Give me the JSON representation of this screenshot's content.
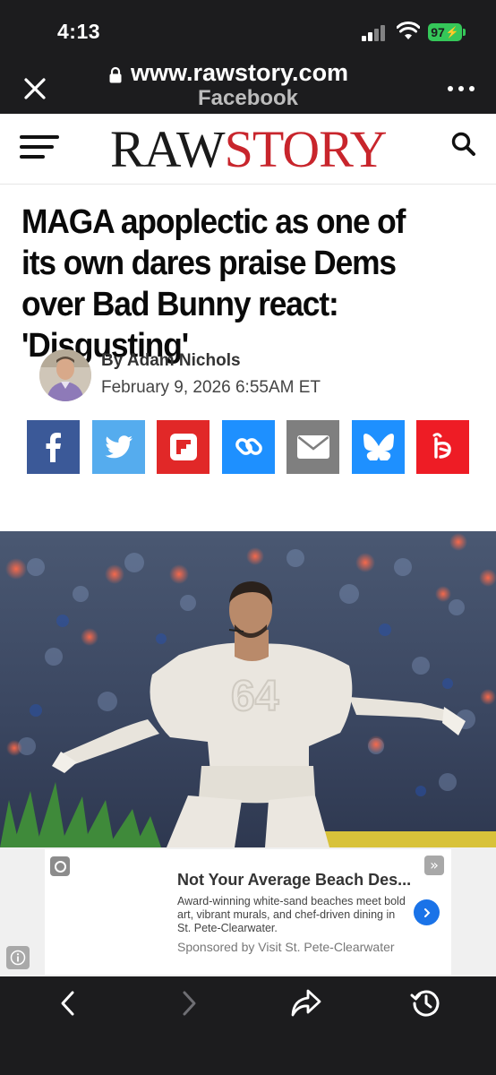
{
  "status_bar": {
    "time": "4:13",
    "battery": "97"
  },
  "browser": {
    "url": "www.rawstory.com",
    "source": "Facebook",
    "icons": [
      "close-icon",
      "lock-icon",
      "more-icon"
    ]
  },
  "site": {
    "logo_raw": "RAW",
    "logo_story": "STORY",
    "brand_color": "#c8252c",
    "icons": [
      "menu-icon",
      "search-icon"
    ]
  },
  "article": {
    "headline": "MAGA apoplectic as one of its own dares praise Dems over Bad Bunny react: 'Disgusting'",
    "byline": "By Adam Nichols",
    "date": "February 9, 2026 6:55AM ET"
  },
  "share": [
    {
      "name": "facebook",
      "color": "#3b5998"
    },
    {
      "name": "twitter",
      "color": "#55acee"
    },
    {
      "name": "flipboard",
      "color": "#e12828"
    },
    {
      "name": "copy-link",
      "color": "#1e90ff"
    },
    {
      "name": "email",
      "color": "#7f7f7f"
    },
    {
      "name": "bluesky",
      "color": "#1e90ff"
    },
    {
      "name": "beehiiv",
      "color": "#ee1c25"
    }
  ],
  "ad": {
    "title": "Not Your Average Beach Des...",
    "body": "Award-winning white-sand beaches meet bold art, vibrant murals, and chef-driven dining in St. Pete-Clearwater.",
    "sponsor": "Sponsored by Visit St. Pete-Clearwater",
    "cta_color": "#1a73e8"
  },
  "toolbar": {
    "icons": [
      "back-icon",
      "forward-icon",
      "share-icon",
      "history-icon"
    ]
  }
}
